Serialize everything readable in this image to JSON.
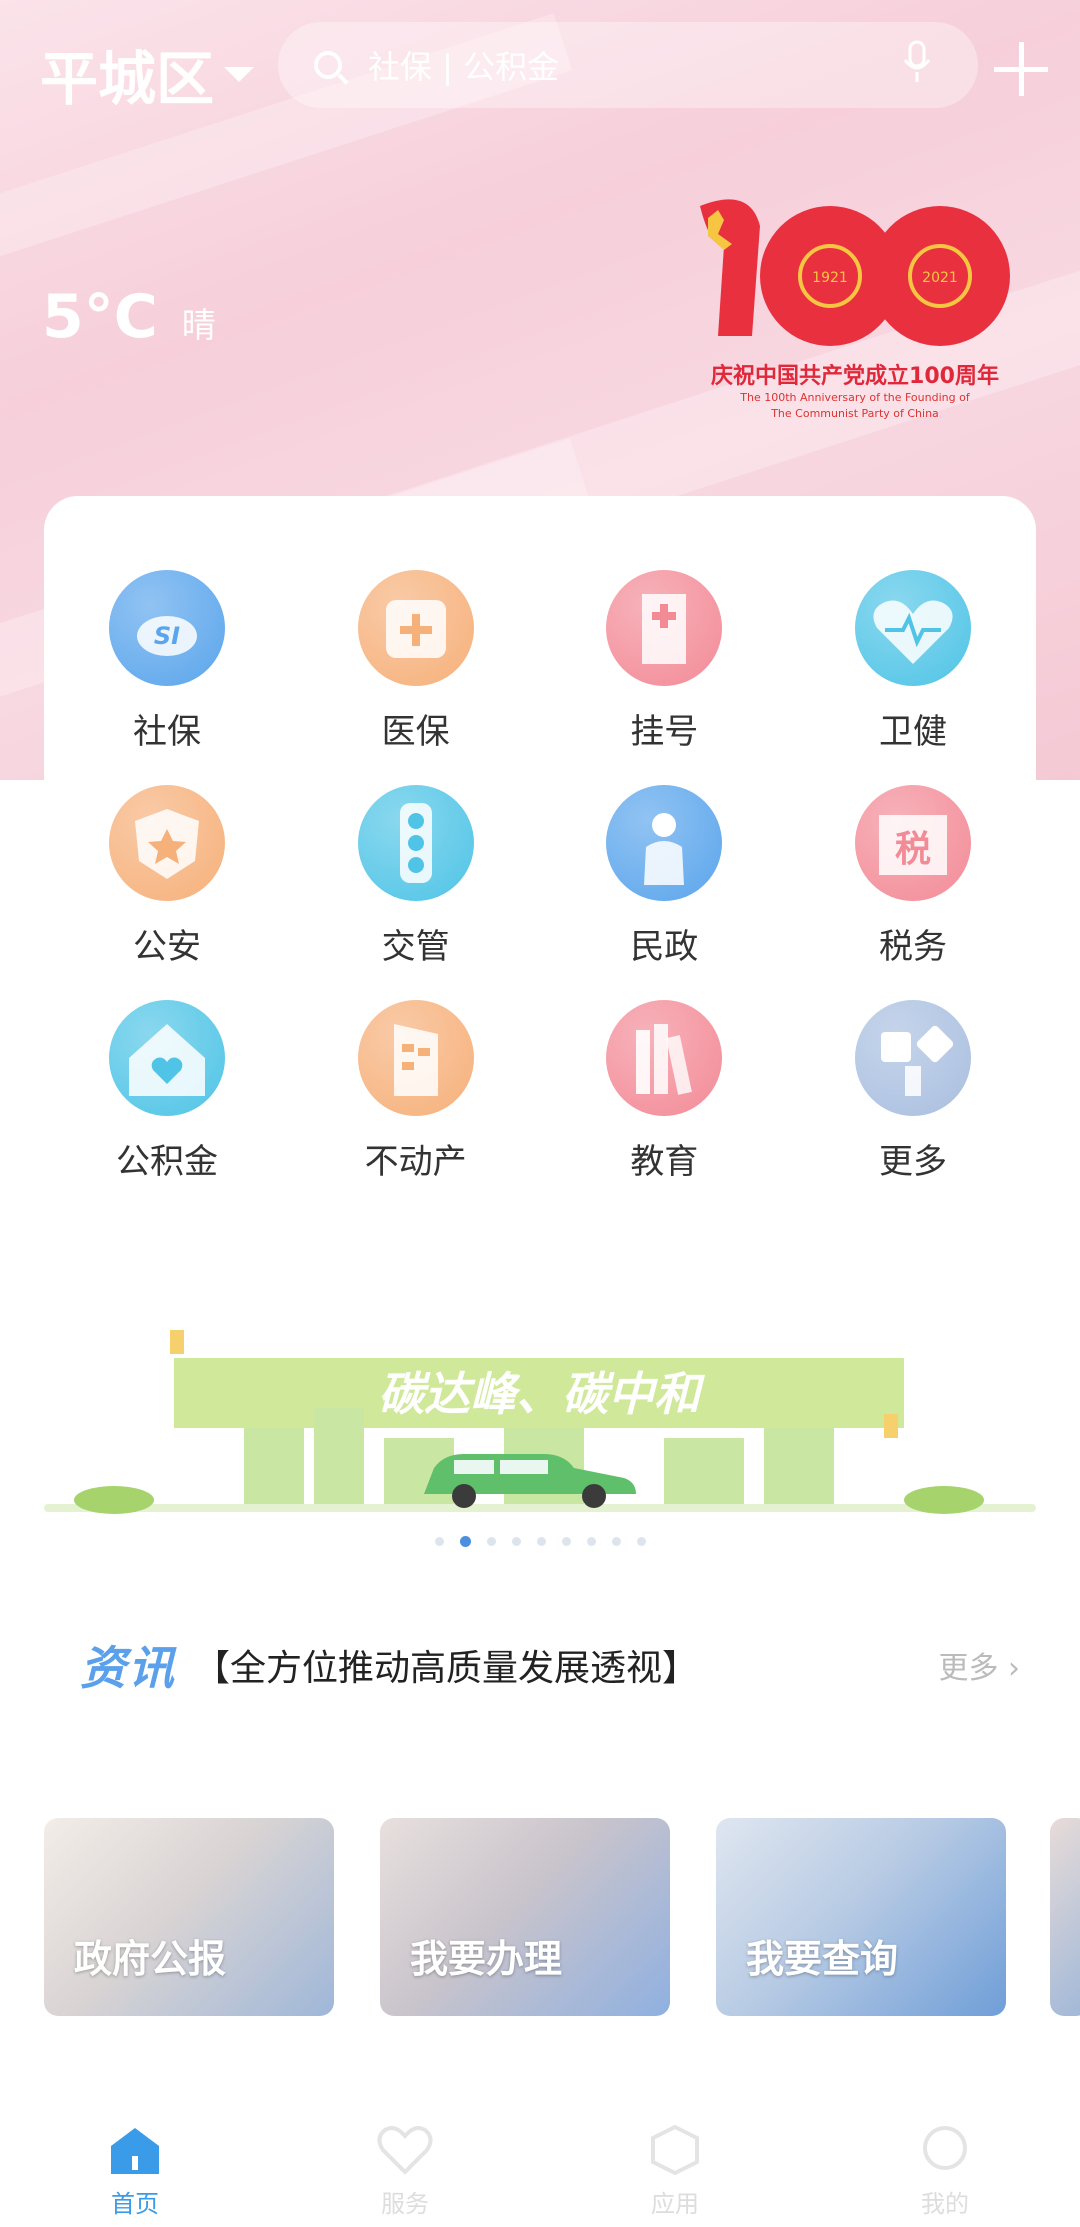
{
  "header": {
    "district": "平城区",
    "search_placeholder": "社保 | 公积金"
  },
  "weather": {
    "temperature": "5°C",
    "condition": "晴"
  },
  "anniversary": {
    "caption": "庆祝中国共产党成立100周年",
    "sub1": "The 100th Anniversary of the Founding of",
    "sub2": "The Communist Party of China",
    "year_start": "1921",
    "year_end": "2021"
  },
  "services": [
    {
      "label": "社保",
      "icon": "social-security-icon",
      "color": "#5aa5ec"
    },
    {
      "label": "医保",
      "icon": "medical-insurance-icon",
      "color": "#f6b07a"
    },
    {
      "label": "挂号",
      "icon": "hospital-icon",
      "color": "#f38b97"
    },
    {
      "label": "卫健",
      "icon": "heart-pulse-icon",
      "color": "#4fc4e6"
    },
    {
      "label": "公安",
      "icon": "police-badge-icon",
      "color": "#f6b07a"
    },
    {
      "label": "交管",
      "icon": "traffic-light-icon",
      "color": "#4fc4e6"
    },
    {
      "label": "民政",
      "icon": "person-icon",
      "color": "#5aa5ec"
    },
    {
      "label": "税务",
      "icon": "tax-icon",
      "color": "#f38b97"
    },
    {
      "label": "公积金",
      "icon": "house-heart-icon",
      "color": "#4fc4e6"
    },
    {
      "label": "不动产",
      "icon": "building-icon",
      "color": "#f6b07a"
    },
    {
      "label": "教育",
      "icon": "books-icon",
      "color": "#f38b97"
    },
    {
      "label": "更多",
      "icon": "more-shapes-icon",
      "color": "#a9bfe0"
    }
  ],
  "banner": {
    "text": "碳达峰、碳中和"
  },
  "carousel": {
    "count": 9,
    "active": 1
  },
  "news": {
    "brand": "资讯",
    "headline": "【全方位推动高质量发展透视】",
    "more": "更多"
  },
  "cards": [
    {
      "label": "政府公报"
    },
    {
      "label": "我要办理"
    },
    {
      "label": "我要查询"
    }
  ],
  "tabs": [
    {
      "label": "首页",
      "active": true
    },
    {
      "label": "服务",
      "active": false
    },
    {
      "label": "应用",
      "active": false
    },
    {
      "label": "我的",
      "active": false
    }
  ]
}
